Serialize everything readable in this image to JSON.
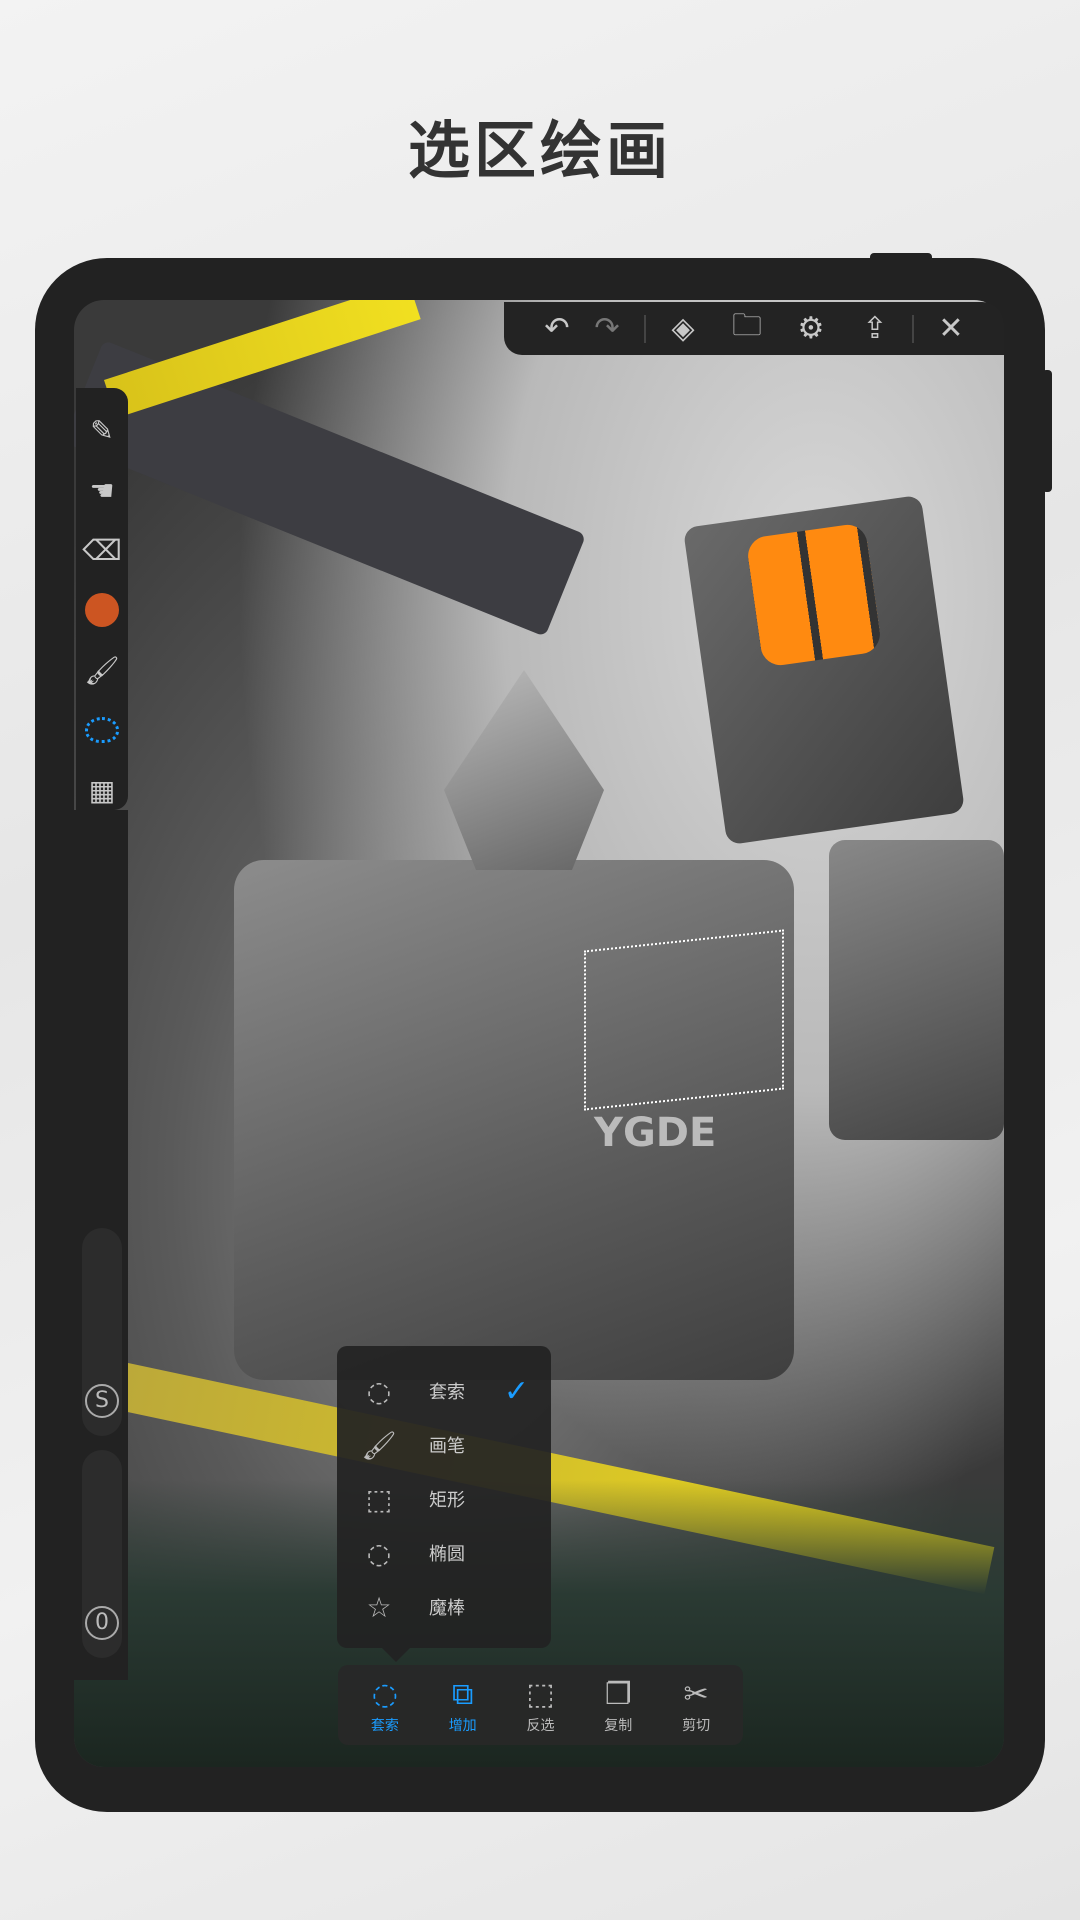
{
  "title": "选区绘画",
  "colors": {
    "accent": "#1a9cff",
    "brush_color": "#cc5522",
    "panel": "#222222"
  },
  "top_toolbar": [
    {
      "icon": "undo-icon"
    },
    {
      "icon": "redo-icon"
    },
    {
      "icon": "layers-icon"
    },
    {
      "icon": "gallery-folder-icon"
    },
    {
      "icon": "gear-icon"
    },
    {
      "icon": "share-icon"
    },
    {
      "icon": "close-icon"
    }
  ],
  "left_toolbar": [
    {
      "icon": "pencil-icon"
    },
    {
      "icon": "smudge-icon"
    },
    {
      "icon": "eraser-icon"
    },
    {
      "icon": "color-swatch-icon"
    },
    {
      "icon": "brush-icon"
    },
    {
      "icon": "lasso-icon",
      "active": true
    },
    {
      "icon": "grid-icon"
    }
  ],
  "sliders": {
    "size_label": "S",
    "opacity_label": "0"
  },
  "selection_menu": {
    "items": [
      {
        "label": "套索",
        "icon": "lasso-icon",
        "checked": true
      },
      {
        "label": "画笔",
        "icon": "brush-select-icon"
      },
      {
        "label": "矩形",
        "icon": "rectangle-select-icon"
      },
      {
        "label": "椭圆",
        "icon": "ellipse-select-icon"
      },
      {
        "label": "魔棒",
        "icon": "magic-wand-icon"
      }
    ]
  },
  "bottom_bar": {
    "items": [
      {
        "label": "套索",
        "icon": "lasso-icon",
        "active": true
      },
      {
        "label": "增加",
        "icon": "add-selection-icon",
        "active": true
      },
      {
        "label": "反选",
        "icon": "invert-selection-icon"
      },
      {
        "label": "复制",
        "icon": "copy-icon"
      },
      {
        "label": "剪切",
        "icon": "cut-icon"
      }
    ]
  },
  "canvas_text": "YGDE"
}
